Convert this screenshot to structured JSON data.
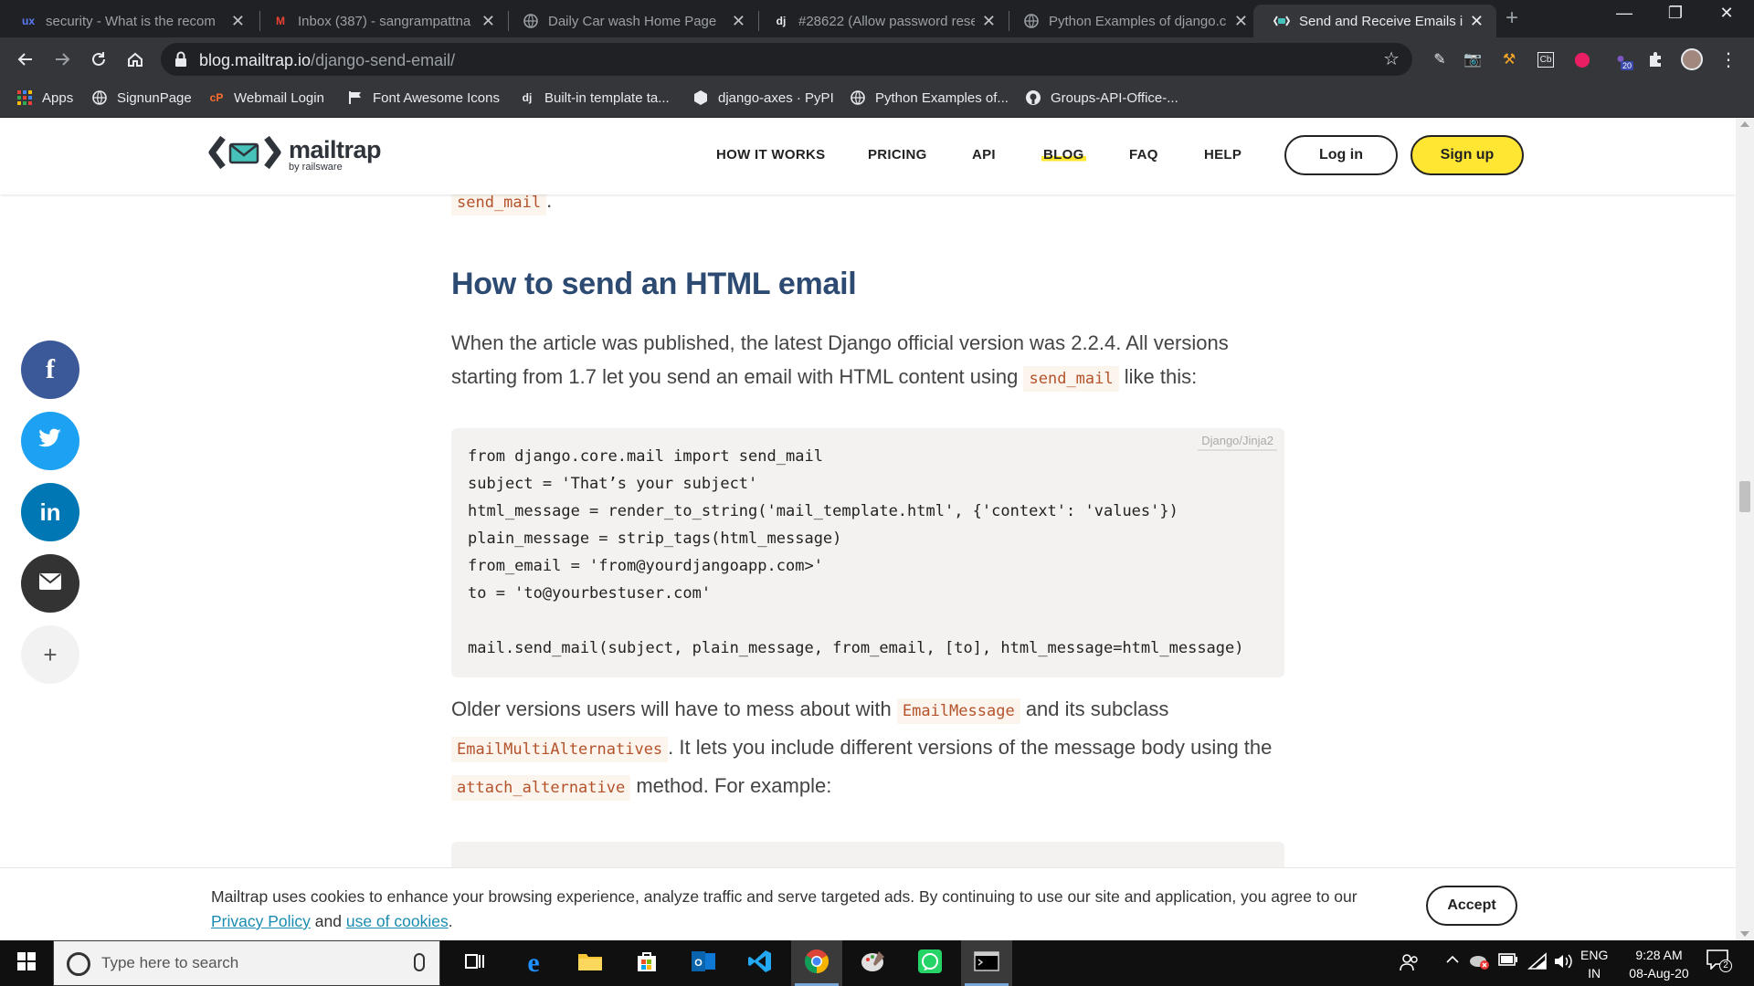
{
  "browser": {
    "tabs": [
      {
        "title": "security - What is the recom",
        "icon": "ux-icon",
        "favicon_text": "ux",
        "active": false
      },
      {
        "title": "Inbox (387) - sangrampattna",
        "icon": "gmail-icon",
        "favicon_text": "M",
        "active": false
      },
      {
        "title": "Daily Car wash Home Page",
        "icon": "globe-icon",
        "favicon_text": "",
        "active": false
      },
      {
        "title": "#28622 (Allow password rese",
        "icon": "django-icon",
        "favicon_text": "dj",
        "active": false
      },
      {
        "title": "Python Examples of django.c",
        "icon": "globe-icon",
        "favicon_text": "",
        "active": false
      },
      {
        "title": "Send and Receive Emails in D",
        "icon": "mailtrap-icon",
        "favicon_text": "",
        "active": true
      }
    ],
    "new_tab": "+",
    "url_host": "blog.mailtrap.io",
    "url_path": "/django-send-email/",
    "extension_badge": "20",
    "bookmarks": [
      {
        "label": "Apps",
        "icon": "apps-grid-icon",
        "icon_text": ""
      },
      {
        "label": "SignunPage",
        "icon": "globe-icon",
        "icon_text": ""
      },
      {
        "label": "Webmail Login",
        "icon": "cpanel-icon",
        "icon_text": "cP"
      },
      {
        "label": "Font Awesome Icons",
        "icon": "flag-icon",
        "icon_text": ""
      },
      {
        "label": "Built-in template ta...",
        "icon": "django-icon",
        "icon_text": "dj"
      },
      {
        "label": "django-axes · PyPI",
        "icon": "pypi-cube-icon",
        "icon_text": ""
      },
      {
        "label": "Python Examples of...",
        "icon": "globe-icon",
        "icon_text": ""
      },
      {
        "label": "Groups-API-Office-...",
        "icon": "github-icon",
        "icon_text": ""
      }
    ]
  },
  "site": {
    "logo_name": "mailtrap",
    "logo_by": "by railsware",
    "nav": [
      {
        "label": "HOW IT WORKS",
        "active": false
      },
      {
        "label": "PRICING",
        "active": false
      },
      {
        "label": "API",
        "active": false
      },
      {
        "label": "BLOG",
        "active": true
      },
      {
        "label": "FAQ",
        "active": false
      },
      {
        "label": "HELP",
        "active": false
      }
    ],
    "login": "Log in",
    "signup": "Sign up",
    "accent": "#ffe633"
  },
  "article": {
    "prev_code": "send_mail",
    "prev_period": ".",
    "heading": "How to send an HTML email",
    "para1_a": "When the article was published, the latest Django official version was 2.2.4. All versions starting from 1.7 let you send an email with HTML content using ",
    "para1_code": "send_mail",
    "para1_b": " like this:",
    "code1_lang": "Django/Jinja2",
    "code1_lines": [
      "from django.core.mail import send_mail",
      "subject = 'That’s your subject'",
      "html_message = render_to_string('mail_template.html', {'context': 'values'})",
      "plain_message = strip_tags(html_message)",
      "from_email = 'from@yourdjangoapp.com>'",
      "to = 'to@yourbestuser.com'",
      "",
      "mail.send_mail(subject, plain_message, from_email, [to], html_message=html_message)"
    ],
    "para2_a": "Older versions users will have to mess about with ",
    "para2_code1": "EmailMessage",
    "para2_b": " and its subclass ",
    "para2_code2": "EmailMultiAlternatives",
    "para2_c": ". It lets you include different versions of the message body using the ",
    "para2_code3": "attach_alternative",
    "para2_d": " method. For example:"
  },
  "social": [
    {
      "icon": "facebook-icon",
      "glyph": "f",
      "color": "#3b5998"
    },
    {
      "icon": "twitter-icon",
      "glyph": "🐦",
      "color": "#1da1f2"
    },
    {
      "icon": "linkedin-icon",
      "glyph": "in",
      "color": "#0077b5"
    },
    {
      "icon": "email-icon",
      "glyph": "✉",
      "color": "#333333"
    },
    {
      "icon": "plus-icon",
      "glyph": "+",
      "color": "#f2f2f2"
    }
  ],
  "cookie": {
    "text_a": "Mailtrap uses cookies to enhance your browsing experience, analyze traffic and serve targeted ads. By continuing to use our site and application, you agree to our ",
    "link1": "Privacy Policy",
    "text_b": " and ",
    "link2": "use of cookies",
    "text_c": ".",
    "accept": "Accept"
  },
  "taskbar": {
    "search_placeholder": "Type here to search",
    "lang_line1": "ENG",
    "lang_line2": "IN",
    "time": "9:28 AM",
    "date": "08-Aug-20",
    "notif_count": "2"
  }
}
